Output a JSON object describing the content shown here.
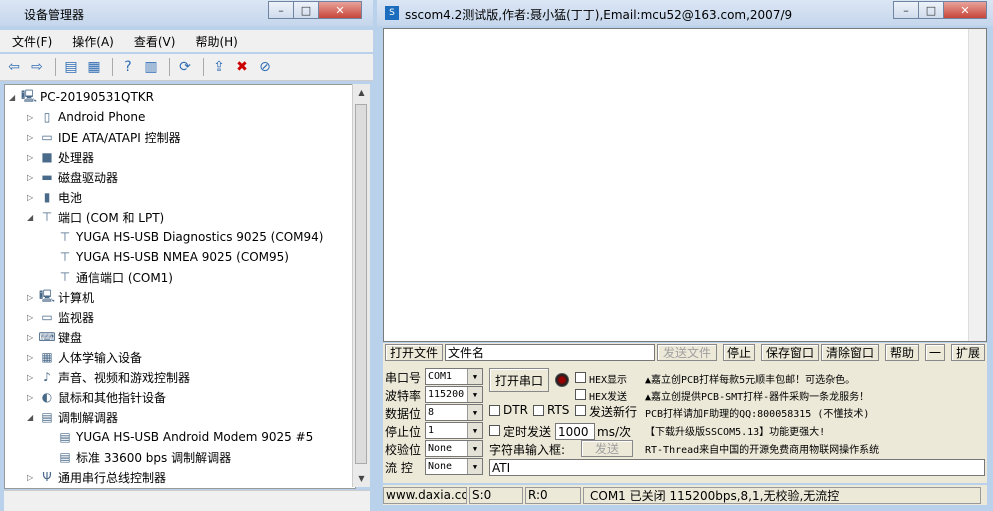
{
  "device_manager": {
    "title": "设备管理器",
    "menu": [
      "文件(F)",
      "操作(A)",
      "查看(V)",
      "帮助(H)"
    ],
    "tree": [
      {
        "label": "PC-20190531QTKR",
        "level": 0,
        "expanded": true,
        "icon": "computer-icon"
      },
      {
        "label": "Android Phone",
        "level": 1,
        "icon": "phone-icon"
      },
      {
        "label": "IDE ATA/ATAPI 控制器",
        "level": 1,
        "icon": "ide-icon"
      },
      {
        "label": "处理器",
        "level": 1,
        "icon": "cpu-icon"
      },
      {
        "label": "磁盘驱动器",
        "level": 1,
        "icon": "disk-icon"
      },
      {
        "label": "电池",
        "level": 1,
        "icon": "battery-icon"
      },
      {
        "label": "端口 (COM 和 LPT)",
        "level": 1,
        "expanded": true,
        "icon": "port-icon"
      },
      {
        "label": "YUGA HS-USB Diagnostics 9025 (COM94)",
        "level": 2,
        "icon": "port-icon"
      },
      {
        "label": "YUGA HS-USB NMEA 9025 (COM95)",
        "level": 2,
        "icon": "port-icon"
      },
      {
        "label": "通信端口 (COM1)",
        "level": 2,
        "icon": "port-icon"
      },
      {
        "label": "计算机",
        "level": 1,
        "icon": "computer-icon"
      },
      {
        "label": "监视器",
        "level": 1,
        "icon": "monitor-icon"
      },
      {
        "label": "键盘",
        "level": 1,
        "icon": "keyboard-icon"
      },
      {
        "label": "人体学输入设备",
        "level": 1,
        "icon": "hid-icon"
      },
      {
        "label": "声音、视频和游戏控制器",
        "level": 1,
        "icon": "sound-icon"
      },
      {
        "label": "鼠标和其他指针设备",
        "level": 1,
        "icon": "mouse-icon"
      },
      {
        "label": "调制解调器",
        "level": 1,
        "expanded": true,
        "icon": "modem-icon"
      },
      {
        "label": "YUGA HS-USB Android Modem 9025 #5",
        "level": 2,
        "icon": "modem-icon"
      },
      {
        "label": "标准 33600 bps 调制解调器",
        "level": 2,
        "icon": "modem-icon"
      },
      {
        "label": "通用串行总线控制器",
        "level": 1,
        "icon": "usb-icon"
      }
    ]
  },
  "sscom": {
    "title": "sscom4.2测试版,作者:聂小猛(丁丁),Email:mcu52@163.com,2007/9",
    "open_file": "打开文件",
    "file_name": "文件名",
    "send_file": "发送文件",
    "stop": "停止",
    "save_window": "保存窗口",
    "clear_window": "清除窗口",
    "help": "帮助",
    "minus": "一",
    "expand": "扩展",
    "port_label": "串口号",
    "port_value": "COM1",
    "baud_label": "波特率",
    "baud_value": "115200",
    "data_label": "数据位",
    "data_value": "8",
    "stop_label": "停止位",
    "stop_value": "1",
    "parity_label": "校验位",
    "parity_value": "None",
    "flow_label": "流 控",
    "flow_value": "None",
    "open_port": "打开串口",
    "hex_display": "HEX显示",
    "hex_send": "HEX发送",
    "send_newline": "发送新行",
    "dtr": "DTR",
    "rts": "RTS",
    "timed_send": "定时发送",
    "interval": "1000",
    "interval_unit": "ms/次",
    "string_input": "字符串输入框:",
    "send": "发送",
    "input_value": "ATI",
    "info_lines": [
      "▲嘉立创PCB打样每款5元顺丰包邮！可选杂色。",
      "▲嘉立创提供PCB-SMT打样-器件采购一条龙服务！",
      "PCB打样请加F助理的QQ:800058315 (不懂技术)",
      "【下载升级版SSCOM5.13】功能更强大!",
      "RT-Thread来自中国的开源免费商用物联网操作系统"
    ],
    "status": [
      "www.daxia.cor",
      "S:0",
      "R:0",
      "COM1 已关闭  115200bps,8,1,无校验,无流控"
    ]
  }
}
